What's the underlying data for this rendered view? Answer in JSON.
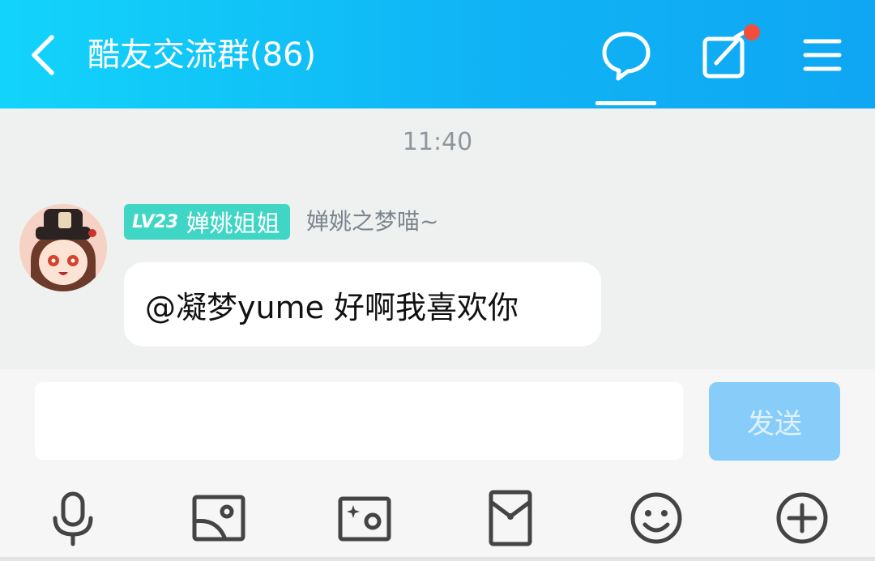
{
  "header": {
    "title": "酷友交流群(86)",
    "background_gradient": [
      "#12d4fb",
      "#0fa6f3"
    ],
    "icons": [
      "back-icon",
      "chat-bubble-icon",
      "edit-icon",
      "menu-icon"
    ],
    "notification_dot_color": "#f24e3b"
  },
  "chat": {
    "timestamp": "11:40",
    "messages": [
      {
        "level_badge": "LV23",
        "member_title": "婵姚姐姐",
        "sender_name": "婵姚之梦喵~",
        "text": "@凝梦yume 好啊我喜欢你"
      }
    ],
    "badge_color": "#3fd6c6"
  },
  "composer": {
    "input_value": "",
    "send_label": "发送",
    "send_color": "#88cdf9"
  },
  "toolbar": {
    "icons": [
      "microphone-icon",
      "image-icon",
      "photo-effects-icon",
      "red-packet-icon",
      "emoji-icon",
      "plus-circle-icon"
    ]
  }
}
